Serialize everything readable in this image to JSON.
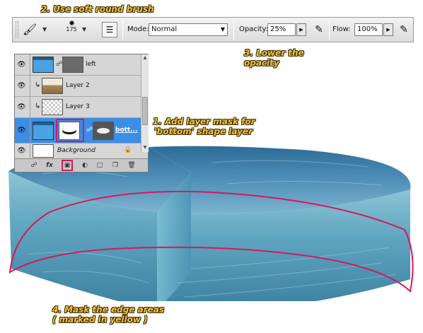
{
  "annotations": {
    "step2": "2. Use soft round brush",
    "step3_line1": "3. Lower the",
    "step3_line2": "opacity",
    "step1_line1": "1. Add layer mask for",
    "step1_line2": "'bottom' shape layer",
    "step4_line1": "4. Mask the edge areas",
    "step4_line2": "( marked in yellow )"
  },
  "options_bar": {
    "brush_size": "175",
    "mode_label": "Mode:",
    "mode_value": "Normal",
    "opacity_label": "Opacity:",
    "opacity_value": "25%",
    "flow_label": "Flow:",
    "flow_value": "100%"
  },
  "layers_panel": {
    "layers": [
      {
        "name": "left",
        "thumbnail": "blue",
        "has_mask": true,
        "selected": false
      },
      {
        "name": "Layer 2",
        "thumbnail": "sand",
        "clipped": true,
        "selected": false
      },
      {
        "name": "Layer 3",
        "thumbnail": "checker",
        "clipped": true,
        "selected": false
      },
      {
        "name": "bott...",
        "thumbnail": "blue",
        "has_mask": true,
        "selected": true
      },
      {
        "name": "Background",
        "thumbnail": "white",
        "locked": true,
        "selected": false
      }
    ],
    "footer_icons": [
      "link-icon",
      "fx-icon",
      "add-mask-icon",
      "adjustment-icon",
      "group-icon",
      "new-layer-icon",
      "trash-icon"
    ]
  },
  "colors": {
    "annotation_text": "#f2c43a",
    "highlight_red": "#d8175e",
    "selected_layer": "#3b8ee6",
    "water_top": "#4f8fb8",
    "water_side": "#6fb0c8"
  }
}
